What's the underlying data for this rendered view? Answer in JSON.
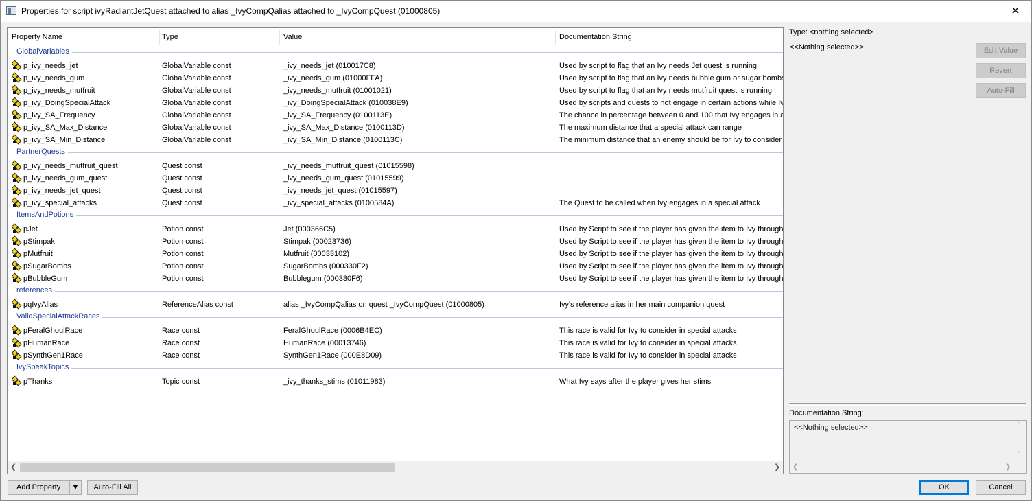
{
  "window": {
    "title": "Properties for script ivyRadiantJetQuest attached to alias _IvyCompQalias attached to _IvyCompQuest (01000805)",
    "close_glyph": "✕"
  },
  "table": {
    "columns": [
      "Property Name",
      "Type",
      "Value",
      "Documentation String"
    ],
    "groups": [
      {
        "label": "GlobalVariables",
        "rows": [
          {
            "name": "p_ivy_needs_jet",
            "type": "GlobalVariable const",
            "value": "_ivy_needs_jet (010017C8)",
            "doc": "Used by script to flag that an Ivy needs Jet quest is running"
          },
          {
            "name": "p_ivy_needs_gum",
            "type": "GlobalVariable const",
            "value": "_ivy_needs_gum (01000FFA)",
            "doc": "Used by script to flag that an Ivy needs bubble gum or sugar bombs"
          },
          {
            "name": "p_ivy_needs_mutfruit",
            "type": "GlobalVariable const",
            "value": "_ivy_needs_mutfruit (01001021)",
            "doc": "Used by script to flag that an Ivy needs mutfruit quest is running"
          },
          {
            "name": "p_ivy_DoingSpecialAttack",
            "type": "GlobalVariable const",
            "value": "_ivy_DoingSpecialAttack (010038E9)",
            "doc": "Used by scripts and quests to not engage in certain actions while Iv"
          },
          {
            "name": "p_ivy_SA_Frequency",
            "type": "GlobalVariable const",
            "value": "_ivy_SA_Frequency (0100113E)",
            "doc": "The chance in percentage between 0 and 100 that Ivy engages in a"
          },
          {
            "name": "p_ivy_SA_Max_Distance",
            "type": "GlobalVariable const",
            "value": "_ivy_SA_Max_Distance (0100113D)",
            "doc": "The maximum distance that a special attack can range"
          },
          {
            "name": "p_ivy_SA_Min_Distance",
            "type": "GlobalVariable const",
            "value": "_ivy_SA_Min_Distance (0100113C)",
            "doc": "The minimum distance that an enemy should be for Ivy to consider a"
          }
        ]
      },
      {
        "label": "PartnerQuests",
        "rows": [
          {
            "name": "p_ivy_needs_mutfruit_quest",
            "type": "Quest const",
            "value": "_ivy_needs_mutfruit_quest (01015598)",
            "doc": ""
          },
          {
            "name": "p_ivy_needs_gum_quest",
            "type": "Quest const",
            "value": "_ivy_needs_gum_quest (01015599)",
            "doc": ""
          },
          {
            "name": "p_ivy_needs_jet_quest",
            "type": "Quest const",
            "value": "_ivy_needs_jet_quest (01015597)",
            "doc": ""
          },
          {
            "name": "p_ivy_special_attacks",
            "type": "Quest const",
            "value": "_ivy_special_attacks (0100584A)",
            "doc": "The Quest to be called when Ivy engages in a special attack"
          }
        ]
      },
      {
        "label": "ItemsAndPotions",
        "rows": [
          {
            "name": "pJet",
            "type": "Potion const",
            "value": "Jet (000366C5)",
            "doc": "Used by Script to see if the player has given the item to Ivy through"
          },
          {
            "name": "pStimpak",
            "type": "Potion const",
            "value": "Stimpak (00023736)",
            "doc": "Used by Script to see if the player has given the item to Ivy through"
          },
          {
            "name": "pMutfruit",
            "type": "Potion const",
            "value": "Mutfruit (00033102)",
            "doc": "Used by Script to see if the player has given the item to Ivy through"
          },
          {
            "name": "pSugarBombs",
            "type": "Potion const",
            "value": "SugarBombs (000330F2)",
            "doc": "Used by Script to see if the player has given the item to Ivy through"
          },
          {
            "name": "pBubbleGum",
            "type": "Potion const",
            "value": "Bubblegum (000330F6)",
            "doc": "Used by Script to see if the player has given the item to Ivy through"
          }
        ]
      },
      {
        "label": "references",
        "rows": [
          {
            "name": "pqIvyAlias",
            "type": "ReferenceAlias const",
            "value": "alias _IvyCompQalias on quest _IvyCompQuest (01000805)",
            "doc": "Ivy's reference alias in her main companion quest"
          }
        ]
      },
      {
        "label": "ValidSpecialAttackRaces",
        "rows": [
          {
            "name": "pFeralGhoulRace",
            "type": "Race const",
            "value": "FeralGhoulRace (0006B4EC)",
            "doc": "This race is valid for Ivy to consider in special attacks"
          },
          {
            "name": "pHumanRace",
            "type": "Race const",
            "value": "HumanRace (00013746)",
            "doc": "This race is valid for Ivy to consider in special attacks"
          },
          {
            "name": "pSynthGen1Race",
            "type": "Race const",
            "value": "SynthGen1Race (000E8D09)",
            "doc": "This race is valid for Ivy to consider in special attacks"
          }
        ]
      },
      {
        "label": "IvySpeakTopics",
        "rows": [
          {
            "name": "pThanks",
            "type": "Topic const",
            "value": "_ivy_thanks_stims (01011983)",
            "doc": "What Ivy says after the player gives her stims"
          }
        ]
      }
    ]
  },
  "side": {
    "type_text": "Type: <nothing selected>",
    "nothing_selected": "<<Nothing selected>>",
    "edit_value": "Edit Value",
    "revert": "Revert",
    "auto_fill": "Auto-Fill",
    "doc_label": "Documentation String:",
    "doc_value": "<<Nothing selected>>"
  },
  "footer": {
    "add_property": "Add Property",
    "auto_fill_all": "Auto-Fill All",
    "ok": "OK",
    "cancel": "Cancel"
  },
  "colors": {
    "group_label": "#1e3c96",
    "accent": "#0078d7"
  }
}
